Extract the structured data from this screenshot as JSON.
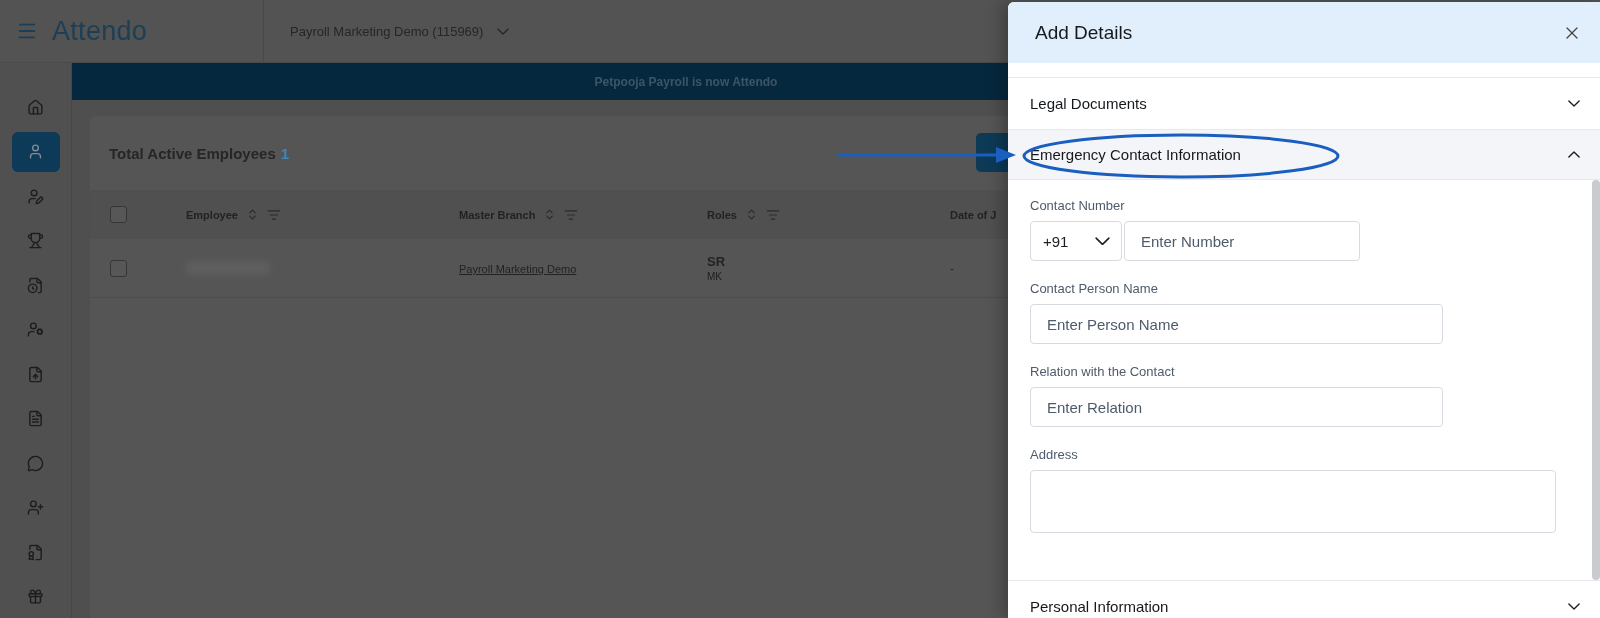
{
  "app": {
    "logo": "Attendo",
    "company": "Payroll Marketing Demo (115969)"
  },
  "sidebar": {
    "items": [
      {
        "selected": false
      },
      {
        "selected": true
      },
      {
        "selected": false
      },
      {
        "selected": false
      },
      {
        "selected": false
      },
      {
        "selected": false
      },
      {
        "selected": false
      },
      {
        "selected": false
      },
      {
        "selected": false
      },
      {
        "selected": false
      },
      {
        "selected": false
      },
      {
        "selected": false
      }
    ]
  },
  "banner": "Petpooja Payroll is now Attendo",
  "card": {
    "title": "Total Active Employees",
    "count": "1",
    "columns": [
      "Employee",
      "Master Branch",
      "Roles",
      "Date of J"
    ],
    "header_checked": false,
    "rows": [
      {
        "checked": false,
        "branch": "Payroll Marketing Demo",
        "role": "SR",
        "role_sub": "MK",
        "date": "-"
      }
    ]
  },
  "drawer": {
    "title": "Add Details",
    "sections": [
      {
        "title": "Legal Documents",
        "expanded": false
      },
      {
        "title": "Emergency Contact Information",
        "expanded": true,
        "fields": [
          {
            "kind": "phone",
            "label": "Contact Number",
            "code": "+91",
            "placeholder": "Enter Number"
          },
          {
            "kind": "text",
            "label": "Contact Person Name",
            "placeholder": "Enter Person Name"
          },
          {
            "kind": "text",
            "label": "Relation with the Contact",
            "placeholder": "Enter Relation"
          },
          {
            "kind": "textarea",
            "label": "Address"
          }
        ]
      },
      {
        "title": "Personal Information",
        "expanded": false
      }
    ]
  }
}
